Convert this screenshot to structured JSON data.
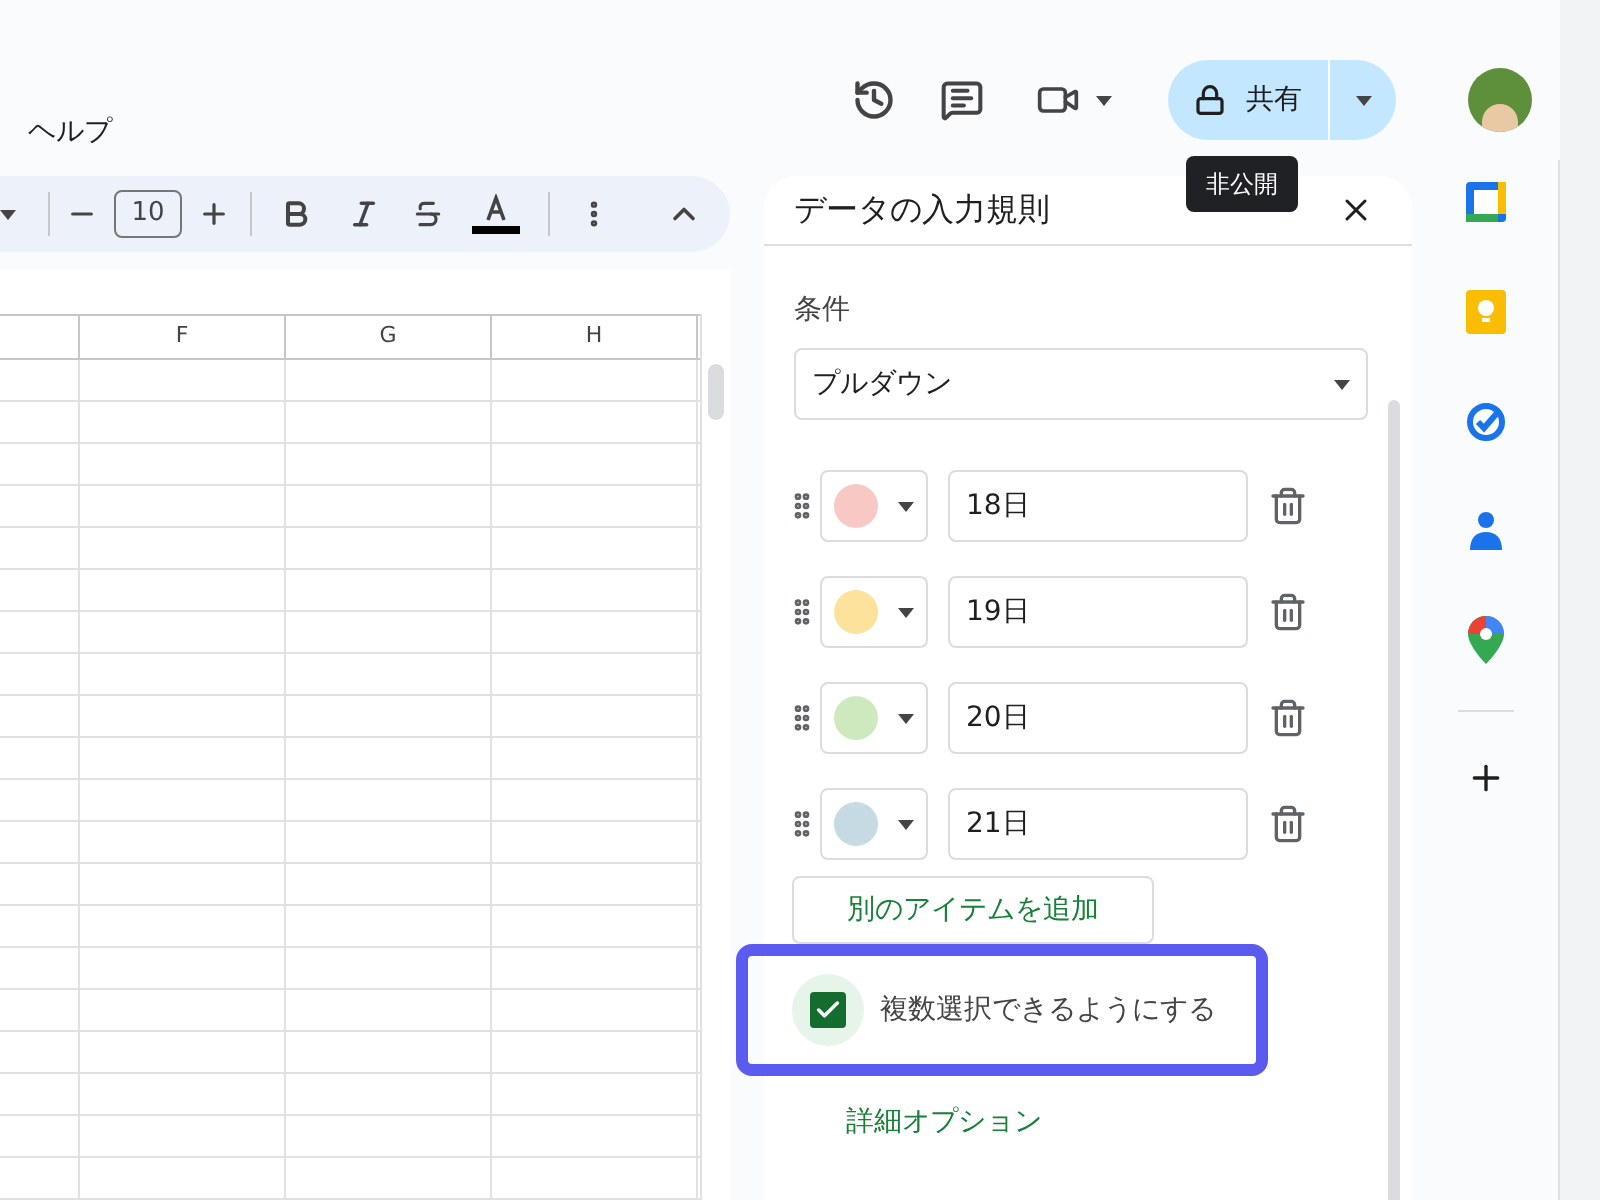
{
  "menu": [
    "ヘルプ"
  ],
  "toolbar": {
    "font_size": "10"
  },
  "grid": {
    "columns": [
      "F",
      "G",
      "H"
    ]
  },
  "share": {
    "label": "共有",
    "tooltip": "非公開"
  },
  "panel": {
    "title": "データの入力規則",
    "condition_label": "条件",
    "criteria": "プルダウン",
    "items": [
      {
        "value": "18日",
        "color": "#f8c9c4"
      },
      {
        "value": "19日",
        "color": "#fce29a"
      },
      {
        "value": "20日",
        "color": "#cfe9bf"
      },
      {
        "value": "21日",
        "color": "#c6dae3"
      }
    ],
    "add_button": "別のアイテムを追加",
    "multi_select": {
      "label": "複数選択できるようにする",
      "checked": true
    },
    "advanced_link": "詳細オプション"
  }
}
